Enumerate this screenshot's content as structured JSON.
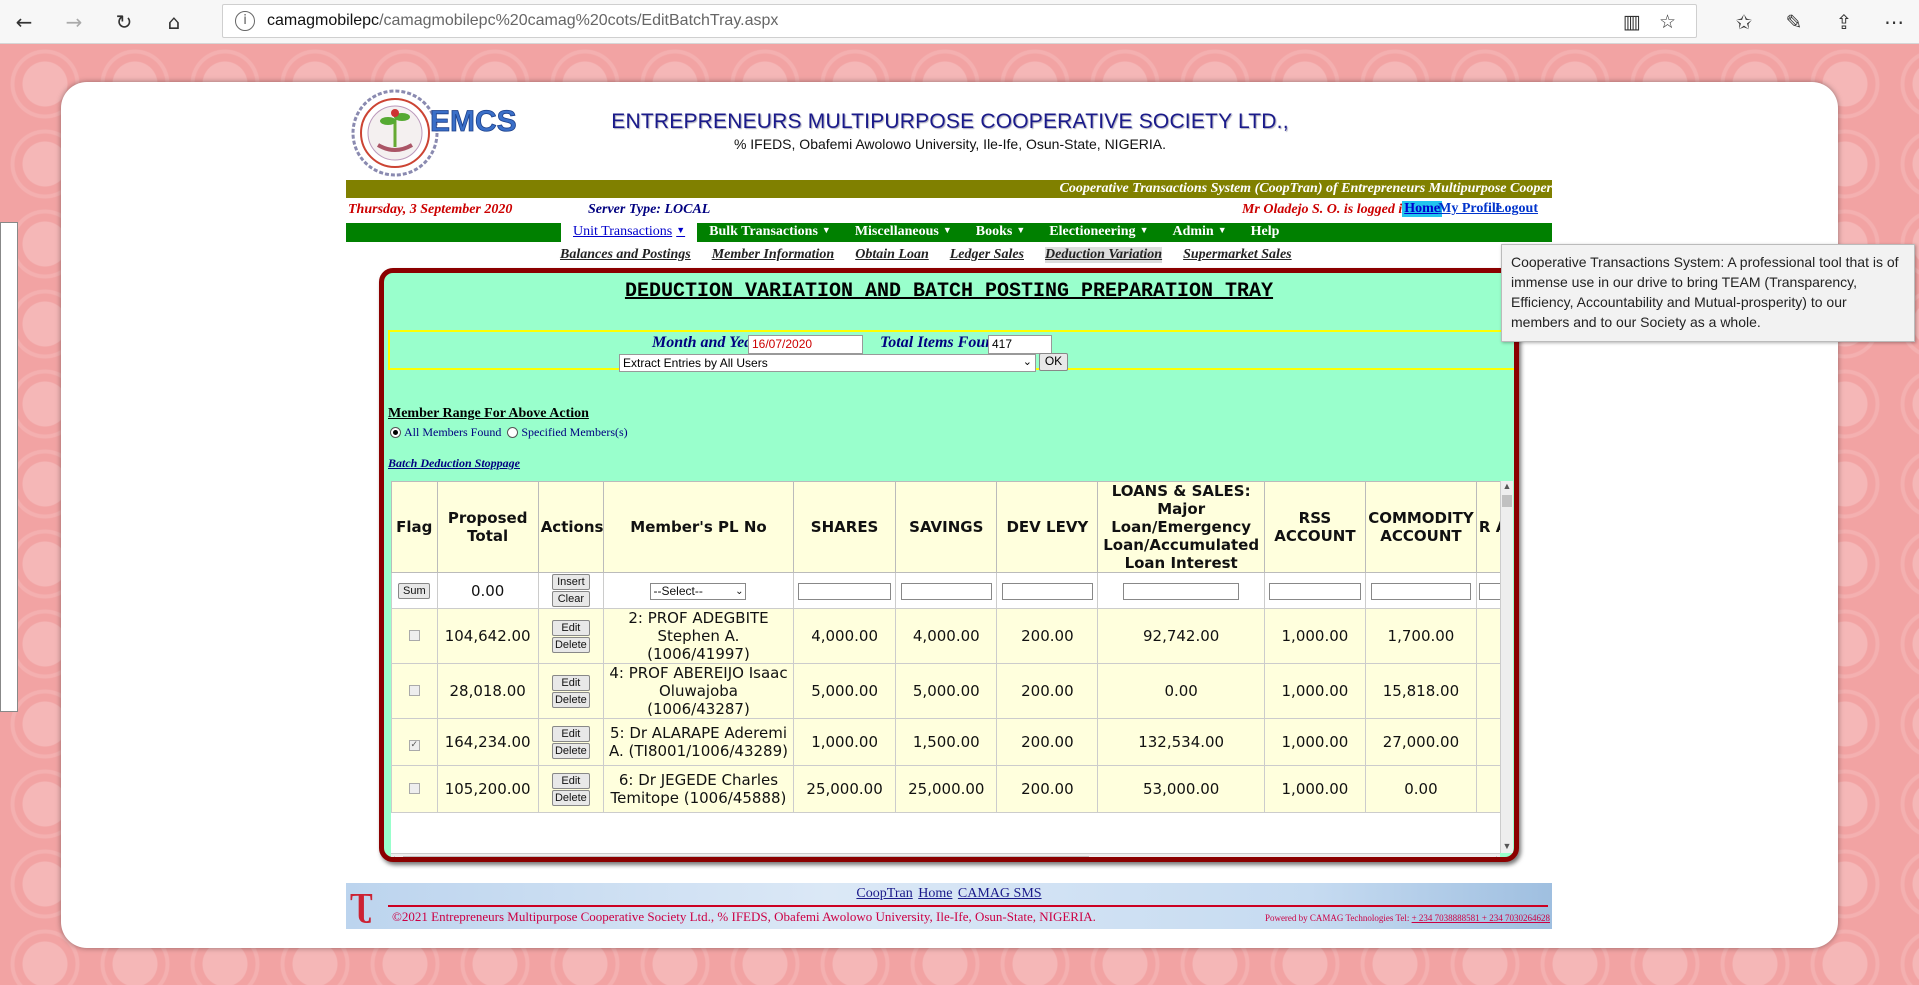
{
  "browser": {
    "url_host": "camagmobilepc",
    "url_path": "/camagmobilepc%20camag%20cots/EditBatchTray.aspx"
  },
  "header": {
    "logo_text": "EMCS",
    "title": "ENTREPRENEURS MULTIPURPOSE COOPERATIVE SOCIETY LTD.,",
    "subtitle": "% IFEDS, Obafemi Awolowo University, Ile-Ife, Osun-State, NIGERIA.",
    "banner": "Cooperative Transactions System (CoopTran) of Entrepreneurs Multipurpose Cooper"
  },
  "info": {
    "date": "Thursday, 3 September 2020",
    "server": "Server Type: LOCAL",
    "login": "Mr Oladejo S. O. is logged in",
    "home": "Home",
    "profile": "My Profile",
    "logout": "Logout"
  },
  "menu": [
    "Unit Transactions",
    "Bulk Transactions",
    "Miscellaneous",
    "Books",
    "Electioneering",
    "Admin",
    "Help"
  ],
  "submenu": [
    "Balances and Postings",
    "Member Information",
    "Obtain Loan",
    "Ledger Sales",
    "Deduction Variation",
    "Supermarket Sales"
  ],
  "tray": {
    "title": "DEDUCTION VARIATION AND BATCH POSTING PREPARATION TRAY",
    "month_label": "Month and Year",
    "month_value": "16/07/2020",
    "total_label": "Total Items Found",
    "total_value": "417",
    "extract_option": "Extract Entries by All Users",
    "ok": "OK",
    "range_title": "Member Range For Above Action",
    "radio_all": "All Members Found",
    "radio_specified": "Specified Members(s)",
    "batch_link": "Batch Deduction Stoppage"
  },
  "table": {
    "headers": [
      "Flag",
      "Proposed Total",
      "Actions",
      "Member's PL No",
      "SHARES",
      "SAVINGS",
      "DEV LEVY",
      "LOANS & SALES: Major Loan/Emergency Loan/Accumulated Loan Interest",
      "RSS ACCOUNT",
      "COMMODITY ACCOUNT",
      "R AC"
    ],
    "sum_button": "Sum",
    "sum_value": "0.00",
    "insert": "Insert",
    "clear": "Clear",
    "select_placeholder": "--Select--",
    "edit": "Edit",
    "delete": "Delete",
    "rows": [
      {
        "checked": false,
        "total": "104,642.00",
        "member": "2: PROF ADEGBITE Stephen A. (1006/41997)",
        "shares": "4,000.00",
        "savings": "4,000.00",
        "dev": "200.00",
        "loans": "92,742.00",
        "rss": "1,000.00",
        "commodity": "1,700.00"
      },
      {
        "checked": false,
        "total": "28,018.00",
        "member": "4: PROF ABEREIJO Isaac Oluwajoba (1006/43287)",
        "shares": "5,000.00",
        "savings": "5,000.00",
        "dev": "200.00",
        "loans": "0.00",
        "rss": "1,000.00",
        "commodity": "15,818.00"
      },
      {
        "checked": true,
        "total": "164,234.00",
        "member": "5: Dr ALARAPE Aderemi A. (TI8001/1006/43289)",
        "shares": "1,000.00",
        "savings": "1,500.00",
        "dev": "200.00",
        "loans": "132,534.00",
        "rss": "1,000.00",
        "commodity": "27,000.00"
      },
      {
        "checked": false,
        "total": "105,200.00",
        "member": "6: Dr JEGEDE Charles Temitope (1006/45888)",
        "shares": "25,000.00",
        "savings": "25,000.00",
        "dev": "200.00",
        "loans": "53,000.00",
        "rss": "1,000.00",
        "commodity": "0.00"
      }
    ]
  },
  "tooltip": "Cooperative Transactions System: A professional tool that is of immense use in our drive to bring TEAM (Transparency, Efficiency, Accountability and Mutual-prosperity) to our members and to our Society as a whole.",
  "footer": {
    "link1": "CoopTran",
    "link2": "Home",
    "link3": "CAMAG SMS",
    "copyright": "©2021 Entrepreneurs Multipurpose Cooperative Society Ltd., % IFEDS, Obafemi Awolowo University, Ile-Ife, Osun-State, NIGERIA.",
    "powered": "Powered by CAMAG Technologies Tel:",
    "phones": "+ 234 7038888581 + 234 7030264628"
  },
  "colors": {
    "olive": "#808000",
    "green": "#008000",
    "tray_bg": "#99ffcc",
    "tray_border": "#8b0000"
  }
}
